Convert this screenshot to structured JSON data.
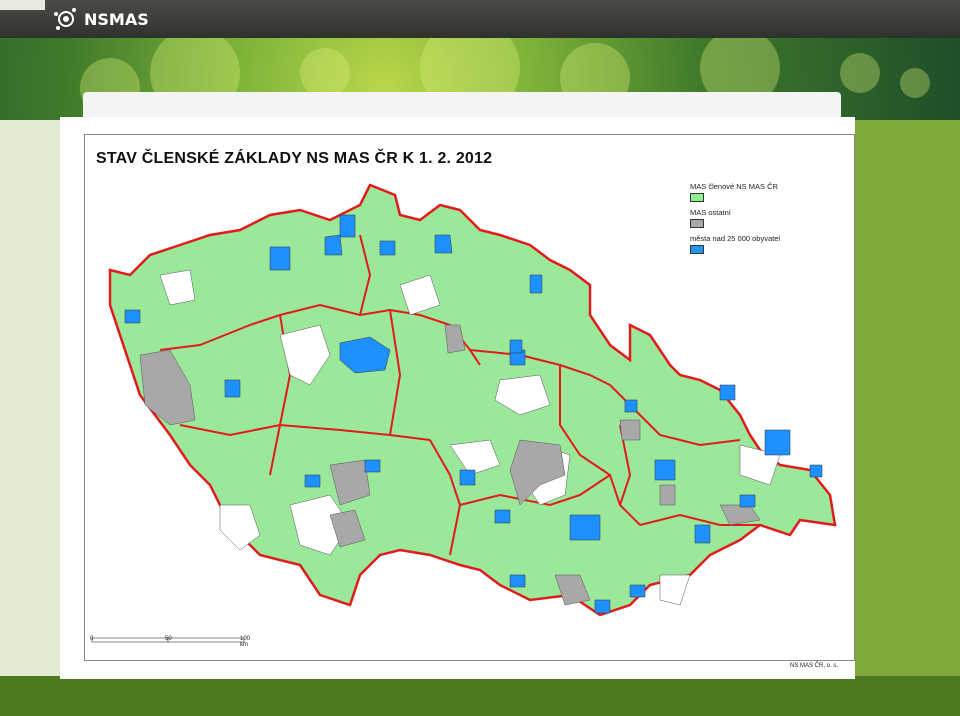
{
  "header": {
    "logo_text": "NSMAS"
  },
  "map": {
    "title": "STAV ČLENSKÉ ZÁKLADY NS MAS ČR K 1. 2. 2012",
    "legend": [
      {
        "label": "MAS členové NS MAS ČR",
        "color": "#90ee90"
      },
      {
        "label": "MAS ostatní",
        "color": "#a8a8a8"
      },
      {
        "label": "města nad 25 000 obyvatel",
        "color": "#2196f3"
      }
    ],
    "scale": {
      "labels": [
        "0",
        "50",
        "100 km"
      ]
    },
    "credit": "NS MAS ČR, o. s.",
    "colors": {
      "member": "#9be89b",
      "other": "#a8a8a8",
      "city": "#1e90ff",
      "border": "#e11b1b"
    }
  }
}
